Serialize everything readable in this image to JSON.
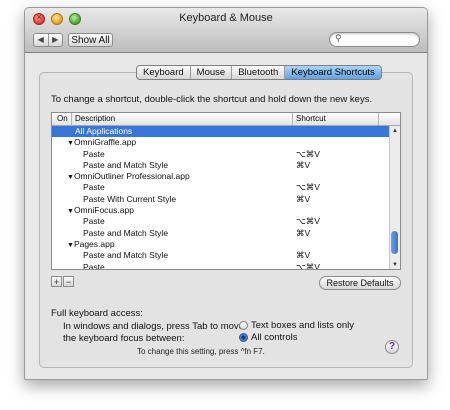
{
  "window": {
    "title": "Keyboard & Mouse"
  },
  "toolbar": {
    "back_glyph": "◀",
    "forward_glyph": "▶",
    "show_all": "Show All",
    "search_value": "",
    "search_icon": "search-icon"
  },
  "tabs": [
    {
      "label": "Keyboard",
      "active": false
    },
    {
      "label": "Mouse",
      "active": false
    },
    {
      "label": "Bluetooth",
      "active": false
    },
    {
      "label": "Keyboard Shortcuts",
      "active": true
    }
  ],
  "instructions": "To change a shortcut, double-click the shortcut and hold down the new keys.",
  "table": {
    "headers": {
      "on": "On",
      "description": "Description",
      "shortcut": "Shortcut"
    },
    "rows": [
      {
        "indent": 1,
        "expand": "",
        "description": "All Applications",
        "shortcut": "",
        "selected": true
      },
      {
        "indent": 1,
        "expand": "▼",
        "description": "OmniGraffle.app",
        "shortcut": "",
        "selected": false
      },
      {
        "indent": 2,
        "expand": "",
        "description": "Paste",
        "shortcut": "⌥⌘V",
        "selected": false
      },
      {
        "indent": 2,
        "expand": "",
        "description": "Paste and Match Style",
        "shortcut": "⌘V",
        "selected": false
      },
      {
        "indent": 1,
        "expand": "▼",
        "description": "OmniOutliner Professional.app",
        "shortcut": "",
        "selected": false
      },
      {
        "indent": 2,
        "expand": "",
        "description": "Paste",
        "shortcut": "⌥⌘V",
        "selected": false
      },
      {
        "indent": 2,
        "expand": "",
        "description": "Paste With Current Style",
        "shortcut": "⌘V",
        "selected": false
      },
      {
        "indent": 1,
        "expand": "▼",
        "description": "OmniFocus.app",
        "shortcut": "",
        "selected": false
      },
      {
        "indent": 2,
        "expand": "",
        "description": "Paste",
        "shortcut": "⌥⌘V",
        "selected": false
      },
      {
        "indent": 2,
        "expand": "",
        "description": "Paste and Match Style",
        "shortcut": "⌘V",
        "selected": false
      },
      {
        "indent": 1,
        "expand": "▼",
        "description": "Pages.app",
        "shortcut": "",
        "selected": false
      },
      {
        "indent": 2,
        "expand": "",
        "description": "Paste and Match Style",
        "shortcut": "⌘V",
        "selected": false
      },
      {
        "indent": 2,
        "expand": "",
        "description": "Paste",
        "shortcut": "⌥⌘V",
        "selected": false
      }
    ]
  },
  "buttons": {
    "add": "+",
    "remove": "−",
    "restore": "Restore Defaults"
  },
  "keyboard_access": {
    "title": "Full keyboard access:",
    "description_line1": "In windows and dialogs, press Tab to move",
    "description_line2": "the keyboard focus between:",
    "options": [
      {
        "label": "Text boxes and lists only",
        "checked": false
      },
      {
        "label": "All controls",
        "checked": true
      }
    ],
    "hint": "To change this setting, press ^fn F7."
  },
  "help": {
    "glyph": "?"
  },
  "colors": {
    "selection": "#3875d7",
    "accent": "#5ea2e6"
  }
}
